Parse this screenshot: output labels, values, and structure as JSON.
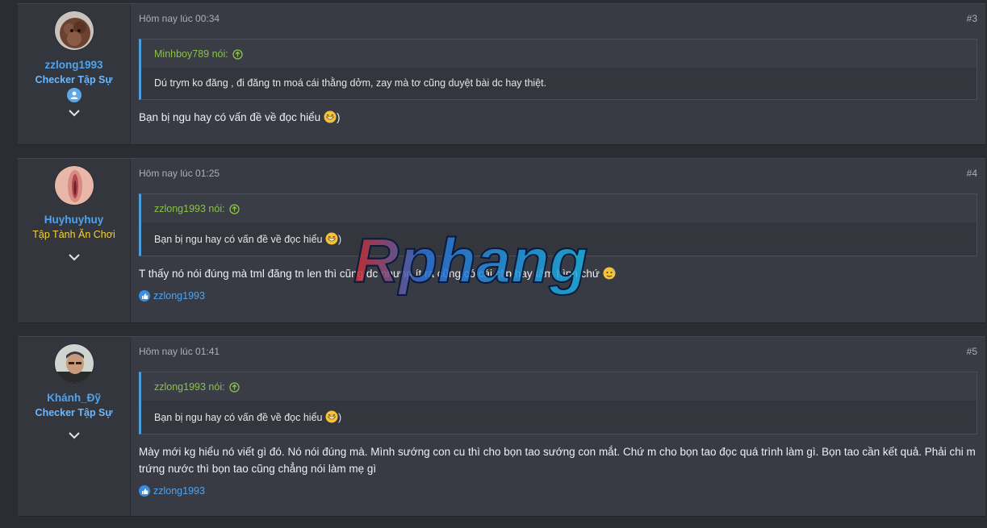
{
  "posts": [
    {
      "time": "Hôm nay lúc 00:34",
      "number": "#3",
      "username": "zzlong1993",
      "usertitle": "Checker Tập Sự",
      "quote_author": "Minhboy789 nói:",
      "quote_text": "Dú trym ko đăng , đi đăng tn moá cái thằng dởm, zay mà tơ cũng duyệt bài dc hay thiệt.",
      "message": "Bạn bị ngu hay có vấn đề về đọc hiểu",
      "message_suffix": ")"
    },
    {
      "time": "Hôm nay lúc 01:25",
      "number": "#4",
      "username": "Huyhuyhuy",
      "usertitle": "Tập Tành Ăn Chơi",
      "quote_author": "zzlong1993 nói:",
      "quote_text": "Bạn bị ngu hay có vấn đề về đọc hiểu",
      "quote_suffix": ")",
      "message": "T thấy nó nói đúng mà tml đăng tn len thì cũng dc nhưng ít ra cũng có cái clip hay tấm hình chứ",
      "reaction_user": "zzlong1993"
    },
    {
      "time": "Hôm nay lúc 01:41",
      "number": "#5",
      "username": "Khánh_Đỹ",
      "usertitle": "Checker Tập Sự",
      "quote_author": "zzlong1993 nói:",
      "quote_text": "Bạn bị ngu hay có vấn đề về đọc hiểu",
      "quote_suffix": ")",
      "message": "Mày mới kg hiểu nó viết gì đó. Nó nói đúng mà. Mình sướng con cu thì cho bọn tao sướng con mắt. Chứ m cho bọn tao đọc quá trình làm gì. Bọn tao cần kết quả. Phải chi m trứng nước thì bọn tao cũng chẳng nói làm mẹ gì",
      "reaction_user": "zzlong1993"
    }
  ],
  "watermark": "Rphang",
  "colors": {
    "background": "#2b2d33",
    "post_bg": "#383b43",
    "username": "#4fa3ef",
    "title_blue": "#6bb8ff",
    "title_yellow": "#f2d13b",
    "quote_author": "#8ac249",
    "quote_border": "#4a9edb"
  },
  "icons": {
    "chevron": "chevron-down-icon",
    "quote_link": "arrow-up-circle-icon",
    "like": "like-icon",
    "emoji": "grin-emoji-icon",
    "badge": "verified-user-icon"
  }
}
